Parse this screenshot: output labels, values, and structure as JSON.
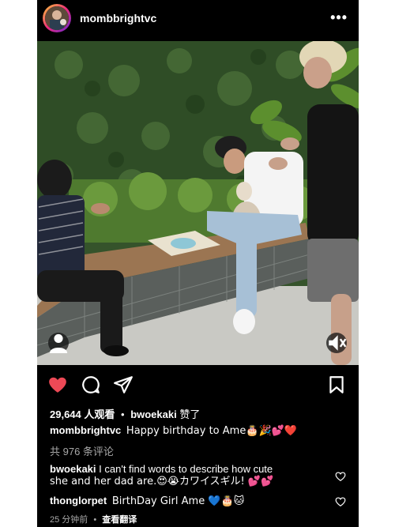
{
  "header": {
    "username": "mombbrightvc",
    "more_icon": "ellipsis-icon"
  },
  "media": {
    "user_tag_icon": "person-icon",
    "mute_icon": "speaker-muted-icon"
  },
  "actions": {
    "like_icon": "heart-filled-icon",
    "comment_icon": "comment-icon",
    "share_icon": "paper-plane-icon",
    "save_icon": "bookmark-icon",
    "like_color": "#ed4956"
  },
  "views": {
    "count": "29,644 人观看",
    "separator": "•",
    "liker": "bwoekaki",
    "liked_suffix": "赞了"
  },
  "caption": {
    "username": "mombbrightvc",
    "text": "Happy birthday to Ame🎂🎉💕❤️"
  },
  "comments_total": "共 976 条评论",
  "comments": [
    {
      "username": "bwoekaki",
      "text_line1": "I can't find words to describe how cute",
      "text_line2": "she and her dad are.😍😭カワイスギル! 💕💕"
    },
    {
      "username": "thonglorpet",
      "text": "BirthDay Girl Ame 💙🎂🐱"
    }
  ],
  "footer": {
    "time": "25 分钟前",
    "separator": "•",
    "translate": "查看翻译"
  }
}
